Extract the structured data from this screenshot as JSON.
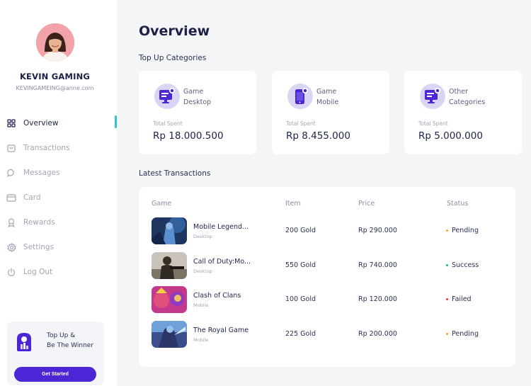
{
  "profile": {
    "name": "KEVIN GAMING",
    "email": "KEVINGAMEING@anne.com"
  },
  "nav": [
    {
      "label": "Overview",
      "icon": "grid-icon",
      "active": true
    },
    {
      "label": "Transactions",
      "icon": "wallet-icon",
      "active": false
    },
    {
      "label": "Messages",
      "icon": "chat-icon",
      "active": false
    },
    {
      "label": "Card",
      "icon": "card-icon",
      "active": false
    },
    {
      "label": "Rewards",
      "icon": "medal-icon",
      "active": false
    },
    {
      "label": "Settings",
      "icon": "gear-icon",
      "active": false
    },
    {
      "label": "Log Out",
      "icon": "power-icon",
      "active": false
    }
  ],
  "promo": {
    "line1": "Top Up &",
    "line2": "Be The Winner",
    "button": "Get Started"
  },
  "main": {
    "title": "Overview",
    "categories_title": "Top Up Categories",
    "transactions_title": "Latest Transactions"
  },
  "categories": [
    {
      "line1": "Game",
      "line2": "Desktop",
      "spent_label": "Total Spent",
      "spent_value": "Rp 18.000.500"
    },
    {
      "line1": "Game",
      "line2": "Mobile",
      "spent_label": "Total Spent",
      "spent_value": "Rp 8.455.000"
    },
    {
      "line1": "Other",
      "line2": "Categories",
      "spent_label": "Total Spent",
      "spent_value": "Rp 5.000.000"
    }
  ],
  "table": {
    "headers": {
      "game": "Game",
      "item": "Item",
      "price": "Price",
      "status": "Status"
    },
    "rows": [
      {
        "game": "Mobile Legend...",
        "platform": "Desktop",
        "item": "200 Gold",
        "price": "Rp 290.000",
        "status": "Pending",
        "status_color": "#f5a623"
      },
      {
        "game": "Call of Duty:Mo...",
        "platform": "Desktop",
        "item": "550 Gold",
        "price": "Rp 740.000",
        "status": "Success",
        "status_color": "#22b573"
      },
      {
        "game": "Clash of Clans",
        "platform": "Mobile",
        "item": "100 Gold",
        "price": "Rp 120.000",
        "status": "Failed",
        "status_color": "#e8404a"
      },
      {
        "game": "The Royal Game",
        "platform": "Mobile",
        "item": "225 Gold",
        "price": "Rp 200.000",
        "status": "Pending",
        "status_color": "#f5a623"
      }
    ]
  },
  "colors": {
    "accent": "#4b25d6",
    "active_indicator": "#2ec4c9",
    "icon_bg": "#d9d6f5"
  }
}
